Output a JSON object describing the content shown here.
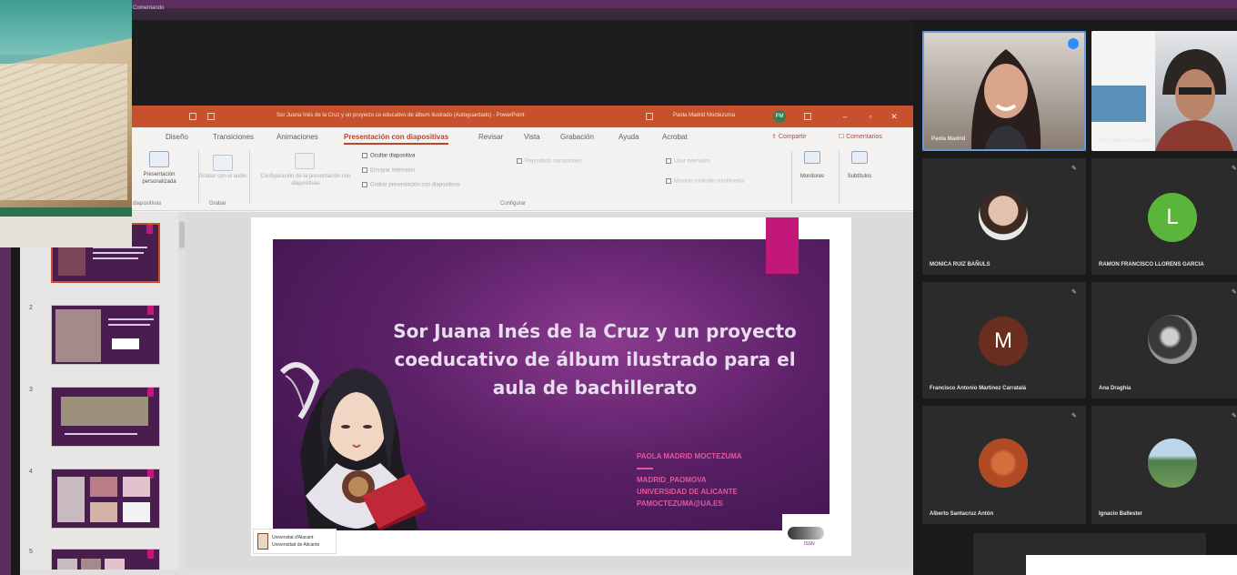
{
  "top_caption": "Comentando",
  "powerpoint": {
    "doc_title": "Sor Juana Inés de la Cruz y un proyecto co educativo de álbum ilustrado (Autoguardado) - PowerPoint",
    "user_name": "Paola Madrid Moctezuma",
    "user_initials": "PM",
    "tabs": [
      "Diseño",
      "Transiciones",
      "Animaciones",
      "Presentación con diapositivas",
      "Revisar",
      "Vista",
      "Grabación",
      "Ayuda",
      "Acrobat"
    ],
    "active_tab": "Presentación con diapositivas",
    "share_label": "Compartir",
    "comments_label": "Comentarios",
    "ribbon": {
      "custom_show": "Presentación personalizada",
      "custom_show_group": "diapositivas",
      "record_label": "Grabar con el audio",
      "record_group": "Grabar",
      "setup_label": "Configuración de la presentación con diapositivas",
      "hide_slide": "Ocultar diapositiva",
      "rehearse": "Ensayar intervalos",
      "record_show": "Grabar presentación con diapositivas",
      "narrations": "Reproducir narraciones",
      "use_timings": "Usar intervalos",
      "show_media": "Mostrar controles multimedia",
      "monitor_label": "Monitores",
      "subtitles_label": "Subtítulos",
      "configure_group": "Configurar"
    },
    "thumbnails": [
      "1",
      "2",
      "3",
      "4",
      "5"
    ],
    "slide": {
      "title": "Sor Juana Inés de la Cruz y un proyecto coeducativo de álbum ilustrado para el aula de bachillerato",
      "info": [
        "PAOLA MADRID MOCTEZUMA",
        "",
        "MADRID_PAOMOVA",
        "UNIVERSIDAD DE ALICANTE",
        "PAMOCTEZUMA@UA.ES"
      ],
      "logo_left_1": "Universitat d'Alacant",
      "logo_left_2": "Universidad de Alicante",
      "logo_right": "ISSN"
    }
  },
  "zoom": {
    "participants": [
      {
        "name": "Paola Madrid",
        "type": "video"
      },
      {
        "name": "CRISTINA COLLADO",
        "type": "video"
      },
      {
        "name": "MONICA RUIZ BAÑULS",
        "type": "photo"
      },
      {
        "name": "RAMON FRANCISCO LLORENS GARCIA",
        "type": "letter",
        "letter": "L",
        "color": "#5bb53a"
      },
      {
        "name": "Francisco Antonio Martínez Carratalá",
        "type": "letter",
        "letter": "M",
        "color": "#6a2e1e"
      },
      {
        "name": "Ana Draghia",
        "type": "photo"
      },
      {
        "name": "Alberto Santacruz Antón",
        "type": "photo"
      },
      {
        "name": "Ignacio Ballester",
        "type": "photo"
      }
    ]
  }
}
